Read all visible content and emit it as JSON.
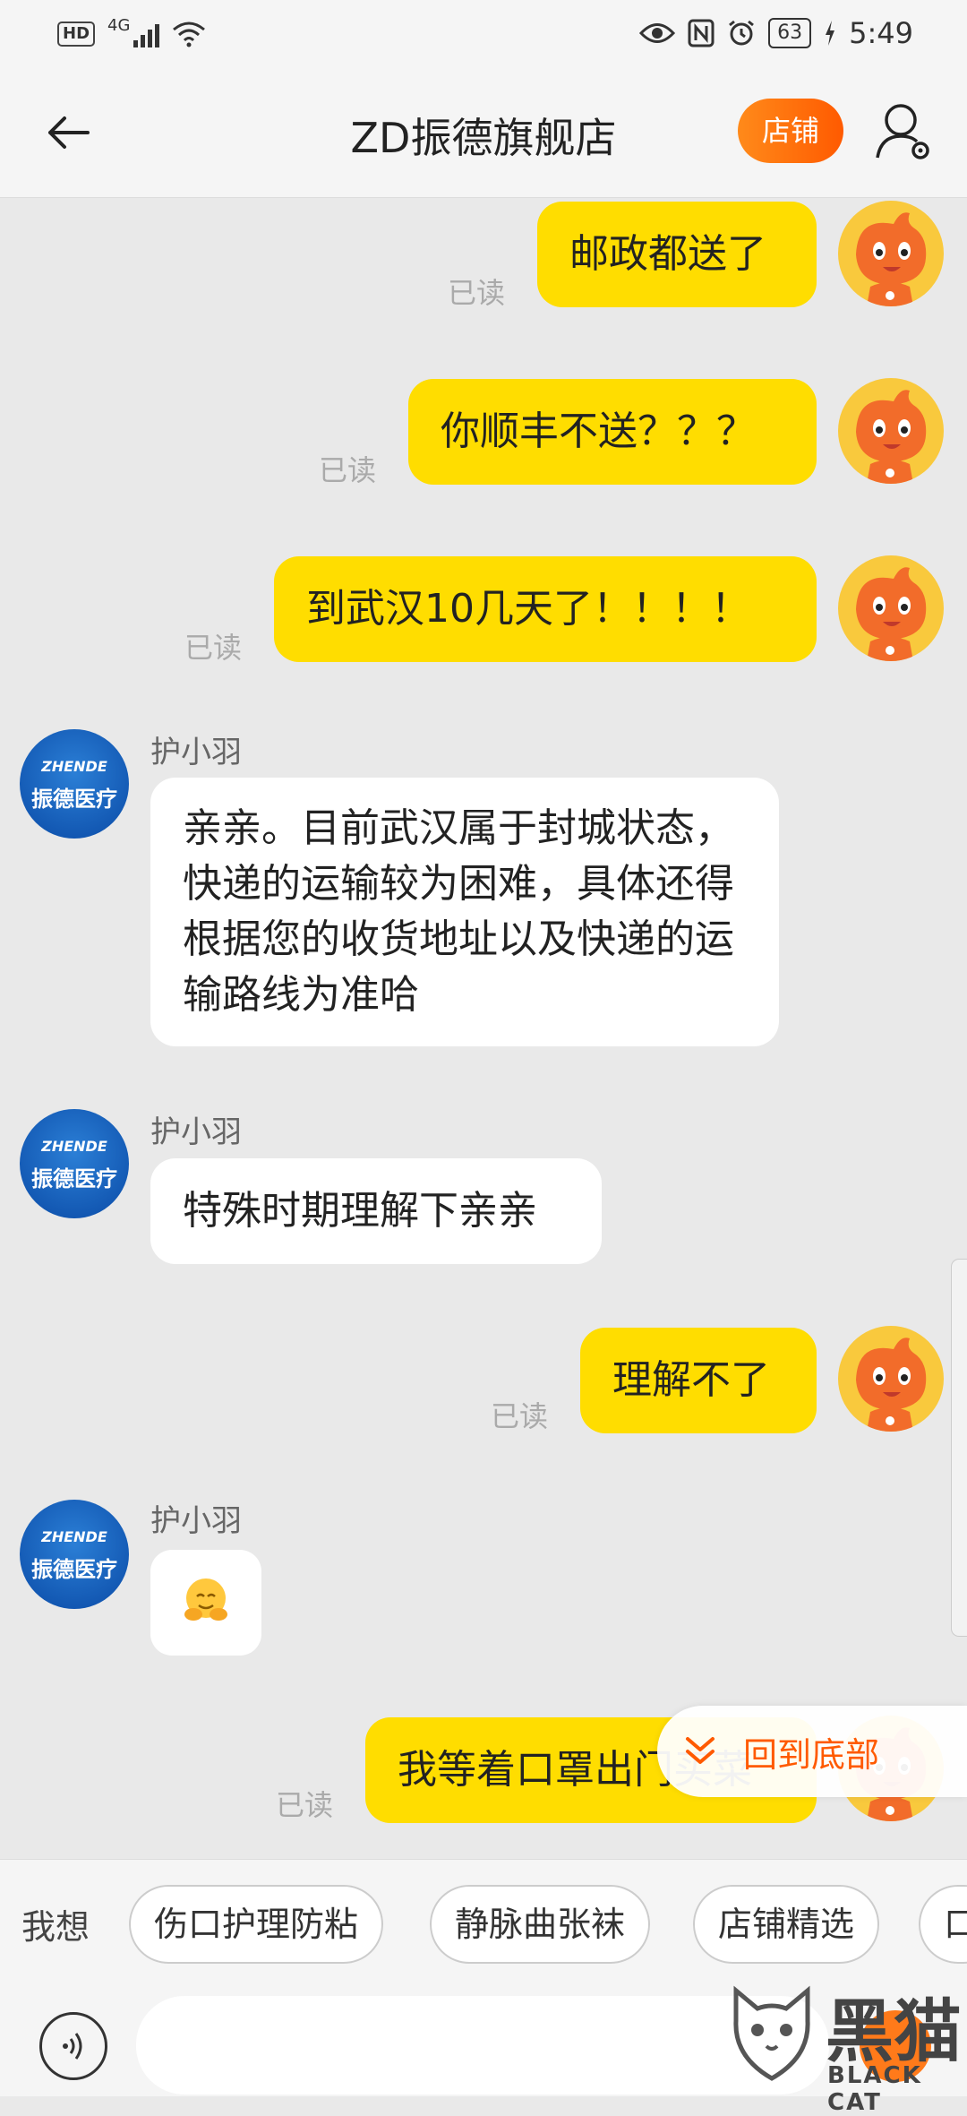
{
  "status_bar": {
    "hd": "HD",
    "network": "4G",
    "battery": "63",
    "time": "5:49"
  },
  "header": {
    "title": "ZD振德旗舰店",
    "shop_button": "店铺"
  },
  "messages": [
    {
      "from": "me",
      "text": "邮政都送了",
      "status": "已读"
    },
    {
      "from": "me",
      "text": "你顺丰不送？？？",
      "status": "已读"
    },
    {
      "from": "me",
      "text": "到武汉10几天了！！！！",
      "status": "已读"
    },
    {
      "from": "shop",
      "sender": "护小羽",
      "text": "亲亲。目前武汉属于封城状态，快递的运输较为困难，具体还得根据您的收货地址以及快递的运输路线为准哈"
    },
    {
      "from": "shop",
      "sender": "护小羽",
      "text": "特殊时期理解下亲亲"
    },
    {
      "from": "me",
      "text": "理解不了",
      "status": "已读"
    },
    {
      "from": "shop",
      "sender": "护小羽",
      "emoji": "hug-face"
    },
    {
      "from": "me",
      "text": "我等着口罩出门买菜",
      "status": "已读"
    }
  ],
  "shop_avatar": {
    "line1": "ZHENDE",
    "line2": "振德医疗",
    "small": "medical"
  },
  "to_bottom": "回到底部",
  "quick_bar": {
    "label": "我想",
    "chips": [
      "伤口护理防粘",
      "静脉曲张袜",
      "店铺精选",
      "口"
    ]
  },
  "watermark": {
    "text": "黑猫",
    "sub": "BLACK CAT"
  },
  "colors": {
    "accent": "#ff5a00",
    "my_bubble": "#ffdd00",
    "shop_bubble": "#ffffff",
    "background": "#e9e9e9"
  }
}
